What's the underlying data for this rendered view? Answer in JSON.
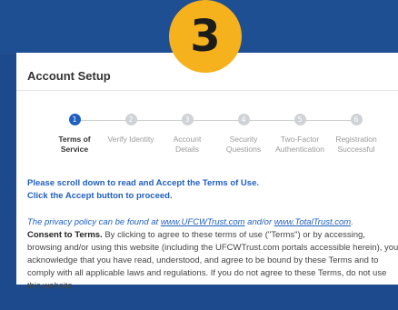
{
  "badge": {
    "number": "3"
  },
  "card": {
    "title": "Account Setup"
  },
  "steps": [
    {
      "num": "1",
      "line1": "Terms of",
      "line2": "Service",
      "active": true
    },
    {
      "num": "2",
      "line1": "Verify Identity",
      "line2": "",
      "active": false
    },
    {
      "num": "3",
      "line1": "Account",
      "line2": "Details",
      "active": false
    },
    {
      "num": "4",
      "line1": "Security",
      "line2": "Questions",
      "active": false
    },
    {
      "num": "5",
      "line1": "Two-Factor",
      "line2": "Authentication",
      "active": false
    },
    {
      "num": "6",
      "line1": "Registration",
      "line2": "Successful",
      "active": false
    }
  ],
  "instructions": {
    "line1": "Please scroll down to read and Accept the Terms of Use.",
    "line2": "Click the Accept button to proceed."
  },
  "privacy": {
    "prefix": "The privacy policy can be found at ",
    "link1": "www.UFCWTrust.com",
    "middle": " and/or ",
    "link2": "www.TotalTrust.com",
    "suffix": "."
  },
  "consent": {
    "heading": "Consent to Terms.",
    "body": " By clicking to agree to these terms of use (\"Terms\") or by accessing, browsing and/or using this website (including the UFCWTrust.com portals accessible herein), you acknowledge that you have read, understood, and agree to be bound by these Terms and to comply with all applicable laws and regulations. If you do not agree to these Terms, do not use this website."
  },
  "colors": {
    "accent": "#1f5fbf",
    "badge": "#f6b21c",
    "background": "#1d4a8c"
  }
}
